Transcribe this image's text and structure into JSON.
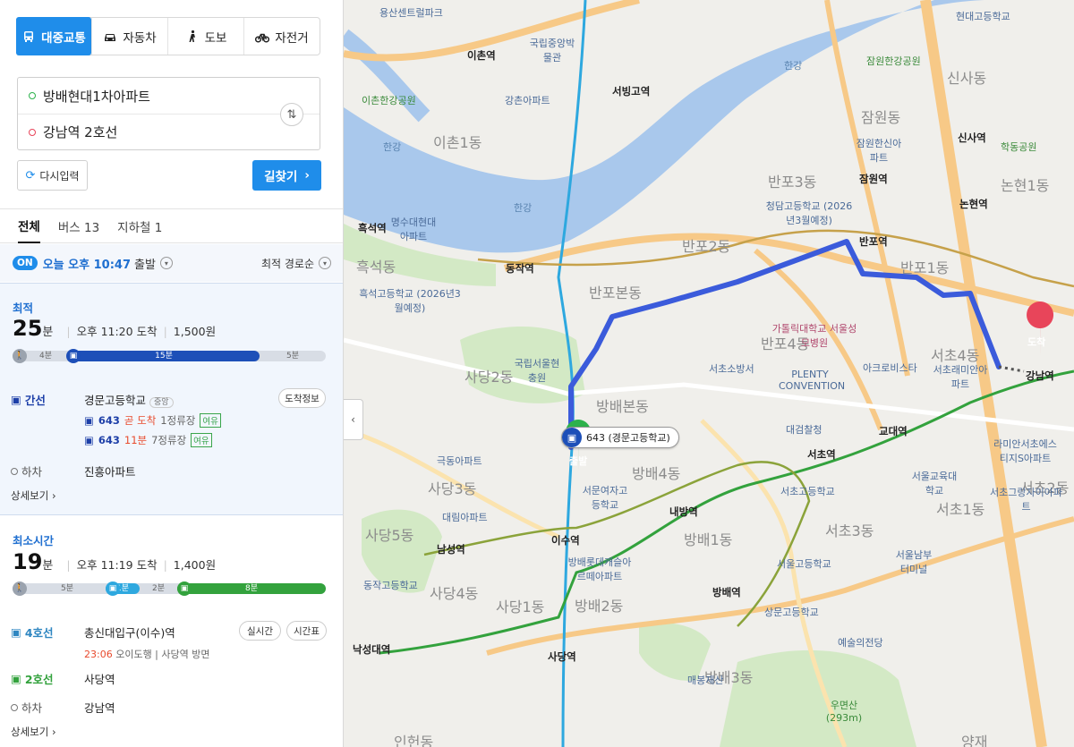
{
  "modes": [
    {
      "label": "대중교통",
      "icon": "bus-icon",
      "active": true
    },
    {
      "label": "자동차",
      "icon": "car-icon"
    },
    {
      "label": "도보",
      "icon": "walk-icon"
    },
    {
      "label": "자전거",
      "icon": "bicycle-icon"
    }
  ],
  "route": {
    "origin": "방배현대1차아파트",
    "destination": "강남역 2호선"
  },
  "buttons": {
    "reset": "다시입력",
    "search": "길찾기"
  },
  "tabs": [
    {
      "label": "전체",
      "active": true
    },
    {
      "label": "버스 13"
    },
    {
      "label": "지하철 1"
    }
  ],
  "departure": {
    "badge": "ON",
    "time": "오늘 오후 10:47",
    "suffix": "출발",
    "sort": "최적 경로순"
  },
  "results": [
    {
      "tag": "최적",
      "minutes": "25",
      "unit": "분",
      "arrival": "오후 11:20 도착",
      "fare": "1,500원",
      "bar": {
        "walk1": "4분",
        "bus": "15분",
        "walk2": "5분"
      },
      "steps": {
        "line": "간선",
        "stop": "경문고등학교",
        "stop_tag": "중앙",
        "info_btn": "도착정보",
        "arrivals": [
          {
            "bus": "643",
            "status": "곧 도착",
            "platform": "1정류장",
            "tag": "여유"
          },
          {
            "bus": "643",
            "status": "11분",
            "platform": "7정류장",
            "tag": "여유"
          }
        ],
        "alight_label": "하차",
        "alight_stop": "진흥아파트"
      },
      "detail": "상세보기"
    },
    {
      "tag": "최소시간",
      "minutes": "19",
      "unit": "분",
      "arrival": "오후 11:19 도착",
      "fare": "1,400원",
      "bar": {
        "walk1": "5분",
        "bus": "1분",
        "walk2": "2분",
        "subway": "8분"
      },
      "steps": {
        "line1": "4호선",
        "stop1": "총신대입구(이수)역",
        "btn_realtime": "실시간",
        "btn_timetable": "시간표",
        "next_time": "23:06",
        "next_desc": "오이도행",
        "next_dir": "사당역 방면",
        "line2": "2호선",
        "stop2": "사당역",
        "alight_label": "하차",
        "alight_stop": "강남역"
      },
      "detail": "상세보기"
    }
  ],
  "map": {
    "bus_callout": "643 (경문고등학교)",
    "start_label": "출발",
    "end_label": "도착",
    "areas": [
      "이촌1동",
      "반포3동",
      "잠원동",
      "신사동",
      "논현1동",
      "반포2동",
      "반포1동",
      "반포본동",
      "흑석동",
      "사당2동",
      "방배본동",
      "반포4동",
      "서초4동",
      "방배4동",
      "사당3동",
      "서초3동",
      "서초1동",
      "사당5동",
      "방배1동",
      "사당4동",
      "사당1동",
      "방배2동",
      "방배3동",
      "서초2동",
      "인헌동",
      "양재"
    ],
    "stations": [
      "이촌역",
      "서빙고역",
      "반포역",
      "논현역",
      "신사역",
      "잠원역",
      "흑석역",
      "동작역",
      "강남역",
      "교대역",
      "서초역",
      "내방역",
      "이수역",
      "남성역",
      "사당역",
      "방배역",
      "낙성대역"
    ],
    "pois": [
      "국립중앙박물관",
      "국립서울현충원",
      "가톨릭대학교 서울성모병원",
      "PLENTY CONVENTION",
      "아크로비스타",
      "서초래미안아파트",
      "서울교육대학교",
      "서문여자고등학교",
      "예술의전당",
      "우면산 (293m)",
      "흑석고등학교 (2026년3월예정)",
      "청담고등학교 (2026년3월예정)",
      "서초소방서",
      "대검찰청",
      "매봉재산",
      "동작고등학교",
      "상문고등학교",
      "서울고등학교",
      "서초고등학교",
      "방배롯데캐슬아르떼아파트",
      "서울남부터미널",
      "극동아파트",
      "대림아파트",
      "명수대현대아파트",
      "잠원한강공원",
      "이촌한강공원",
      "용산센트럴파크",
      "강촌아파트",
      "잠원한신아파트",
      "라미안서초에스티지S아파트",
      "서초그랑자이아파트",
      "현대고등학교",
      "학동공원"
    ],
    "water": [
      "한강"
    ]
  },
  "colors": {
    "accent": "#1f8dea",
    "route": "#3b5bdb",
    "line4": "#2ea8df",
    "line2": "#33a23d",
    "bus_trunk": "#1d3fa8",
    "end_marker": "#e8455a",
    "start_marker": "#2db24c"
  }
}
